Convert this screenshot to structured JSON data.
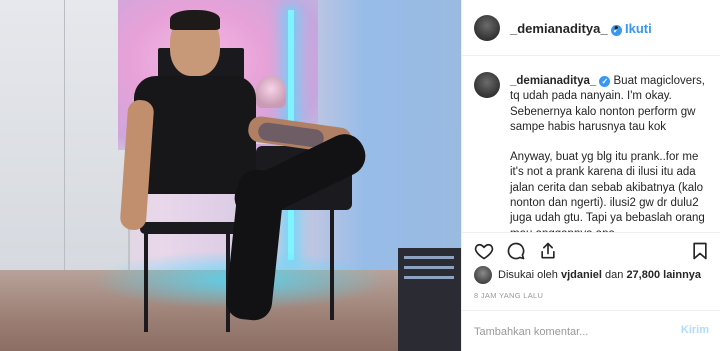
{
  "post": {
    "username": "_demianaditya_",
    "follow_separator": "•",
    "follow_label": "Ikuti",
    "caption": {
      "username": "_demianaditya_",
      "paragraph1": "Buat magiclovers, tq udah pada nanyain. I'm okay. Sebenernya kalo nonton perform gw sampe habis harusnya tau kok",
      "paragraph2": "Anyway, buat yg blg itu prank..for me it's not a prank karena di ilusi itu ada jalan cerita dan sebab akibatnya (kalo nonton dan ngerti). ilusi2 gw dr dulu2 juga udah gtu. Tapi ya bebaslah orang mau anggapnya apa"
    },
    "likes": {
      "prefix": "Disukai oleh",
      "liker": "vjdaniel",
      "connector": "dan",
      "count": "27,800 lainnya"
    },
    "timestamp": "8 JAM YANG LALU",
    "comment_placeholder": "Tambahkan komentar...",
    "post_button": "Kirim"
  },
  "icons": [
    "heart-icon",
    "comment-icon",
    "share-icon",
    "bookmark-icon",
    "verified-badge-icon"
  ],
  "colors": {
    "accent": "#3897f0",
    "text": "#262626",
    "muted": "#999999",
    "post_disabled": "#b3dbff",
    "border": "#efefef"
  }
}
